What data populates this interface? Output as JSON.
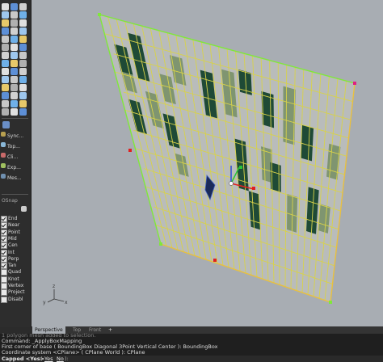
{
  "toolbar": {
    "panel_items": [
      {
        "label": "Sync..."
      },
      {
        "label": "Top..."
      },
      {
        "label": "Cli..."
      },
      {
        "label": "Exp..."
      },
      {
        "label": "Mes..."
      }
    ],
    "osnap_title": "OSnap",
    "snaps": [
      {
        "label": "End",
        "checked": true
      },
      {
        "label": "Near",
        "checked": true
      },
      {
        "label": "Point",
        "checked": true
      },
      {
        "label": "Mid",
        "checked": true
      },
      {
        "label": "Cen",
        "checked": true
      },
      {
        "label": "Int",
        "checked": true
      },
      {
        "label": "Perp",
        "checked": true
      },
      {
        "label": "Tan",
        "checked": true
      },
      {
        "label": "Quad",
        "checked": false
      },
      {
        "label": "Knot",
        "checked": false
      },
      {
        "label": "Vertex",
        "checked": false
      },
      {
        "label": "Project",
        "checked": false
      },
      {
        "label": "Disabl",
        "checked": false
      }
    ]
  },
  "viewport": {
    "axes_label_x": "x",
    "axes_label_y": "y",
    "axes_label_z": "z",
    "colors": {
      "background": "#a8adb3",
      "panel_fill": "#b9bcbb",
      "grid_line": "#d8d24a",
      "edge_highlight": "#80e83a",
      "dark_glass": "#1f4a36",
      "light_glass": "#7f9570",
      "gumball_x": "#e02020",
      "gumball_y": "#27c43a",
      "gumball_z": "#2a4ad8"
    }
  },
  "tabs": [
    {
      "label": "Perspective",
      "active": true
    },
    {
      "label": "Top",
      "active": false
    },
    {
      "label": "Front",
      "active": false
    },
    {
      "label": "+",
      "active": false
    }
  ],
  "command": {
    "history": [
      "1 polygon mesh added to selection.",
      "Command: _ApplyBoxMapping",
      "First corner of base ( BoundingBox  Diagonal  3Point  Vertical  Center ): BoundingBox",
      "Coordinate system <CPlane> ( CPlane  World ): CPlane"
    ],
    "prompt_label": "Capped <Yes>",
    "options": [
      "Yes",
      "No"
    ]
  }
}
